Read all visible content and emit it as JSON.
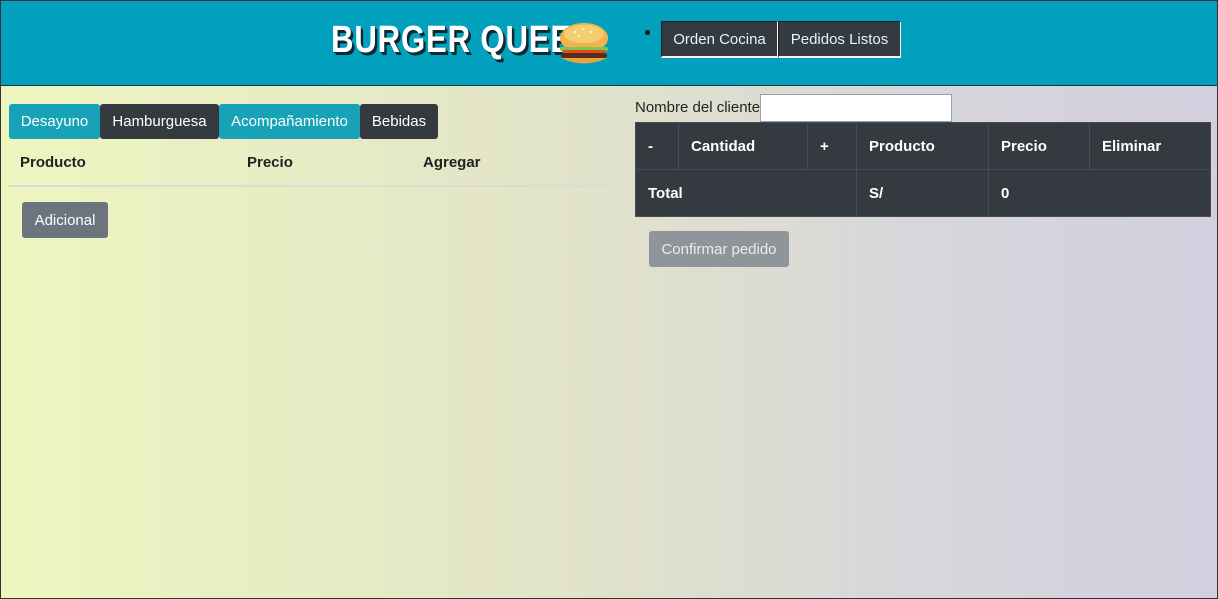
{
  "header": {
    "title": "BURGER QUEEN",
    "logo_icon": "burger-icon",
    "nav": [
      {
        "label": "Orden Cocina"
      },
      {
        "label": "Pedidos Listos"
      }
    ]
  },
  "menu": {
    "tabs": [
      {
        "label": "Desayuno",
        "color": "#17a2b8"
      },
      {
        "label": "Hamburguesa",
        "color": "#343a40"
      },
      {
        "label": "Acompañamiento",
        "color": "#17a2b8"
      },
      {
        "label": "Bebidas",
        "color": "#343a40"
      }
    ],
    "columns": [
      "Producto",
      "Precio",
      "Agregar"
    ],
    "additional_button": "Adicional"
  },
  "order": {
    "client_label": "Nombre del cliente",
    "client_value": "",
    "columns": [
      "-",
      "Cantidad",
      "+",
      "Producto",
      "Precio",
      "Eliminar"
    ],
    "total_label": "Total",
    "currency": "S/",
    "total_value": "0",
    "confirm_button": "Confirmar pedido"
  },
  "colors": {
    "header_bg": "#01a0bd",
    "dark": "#343a40",
    "teal": "#17a2b8",
    "secondary": "#6c757d"
  }
}
